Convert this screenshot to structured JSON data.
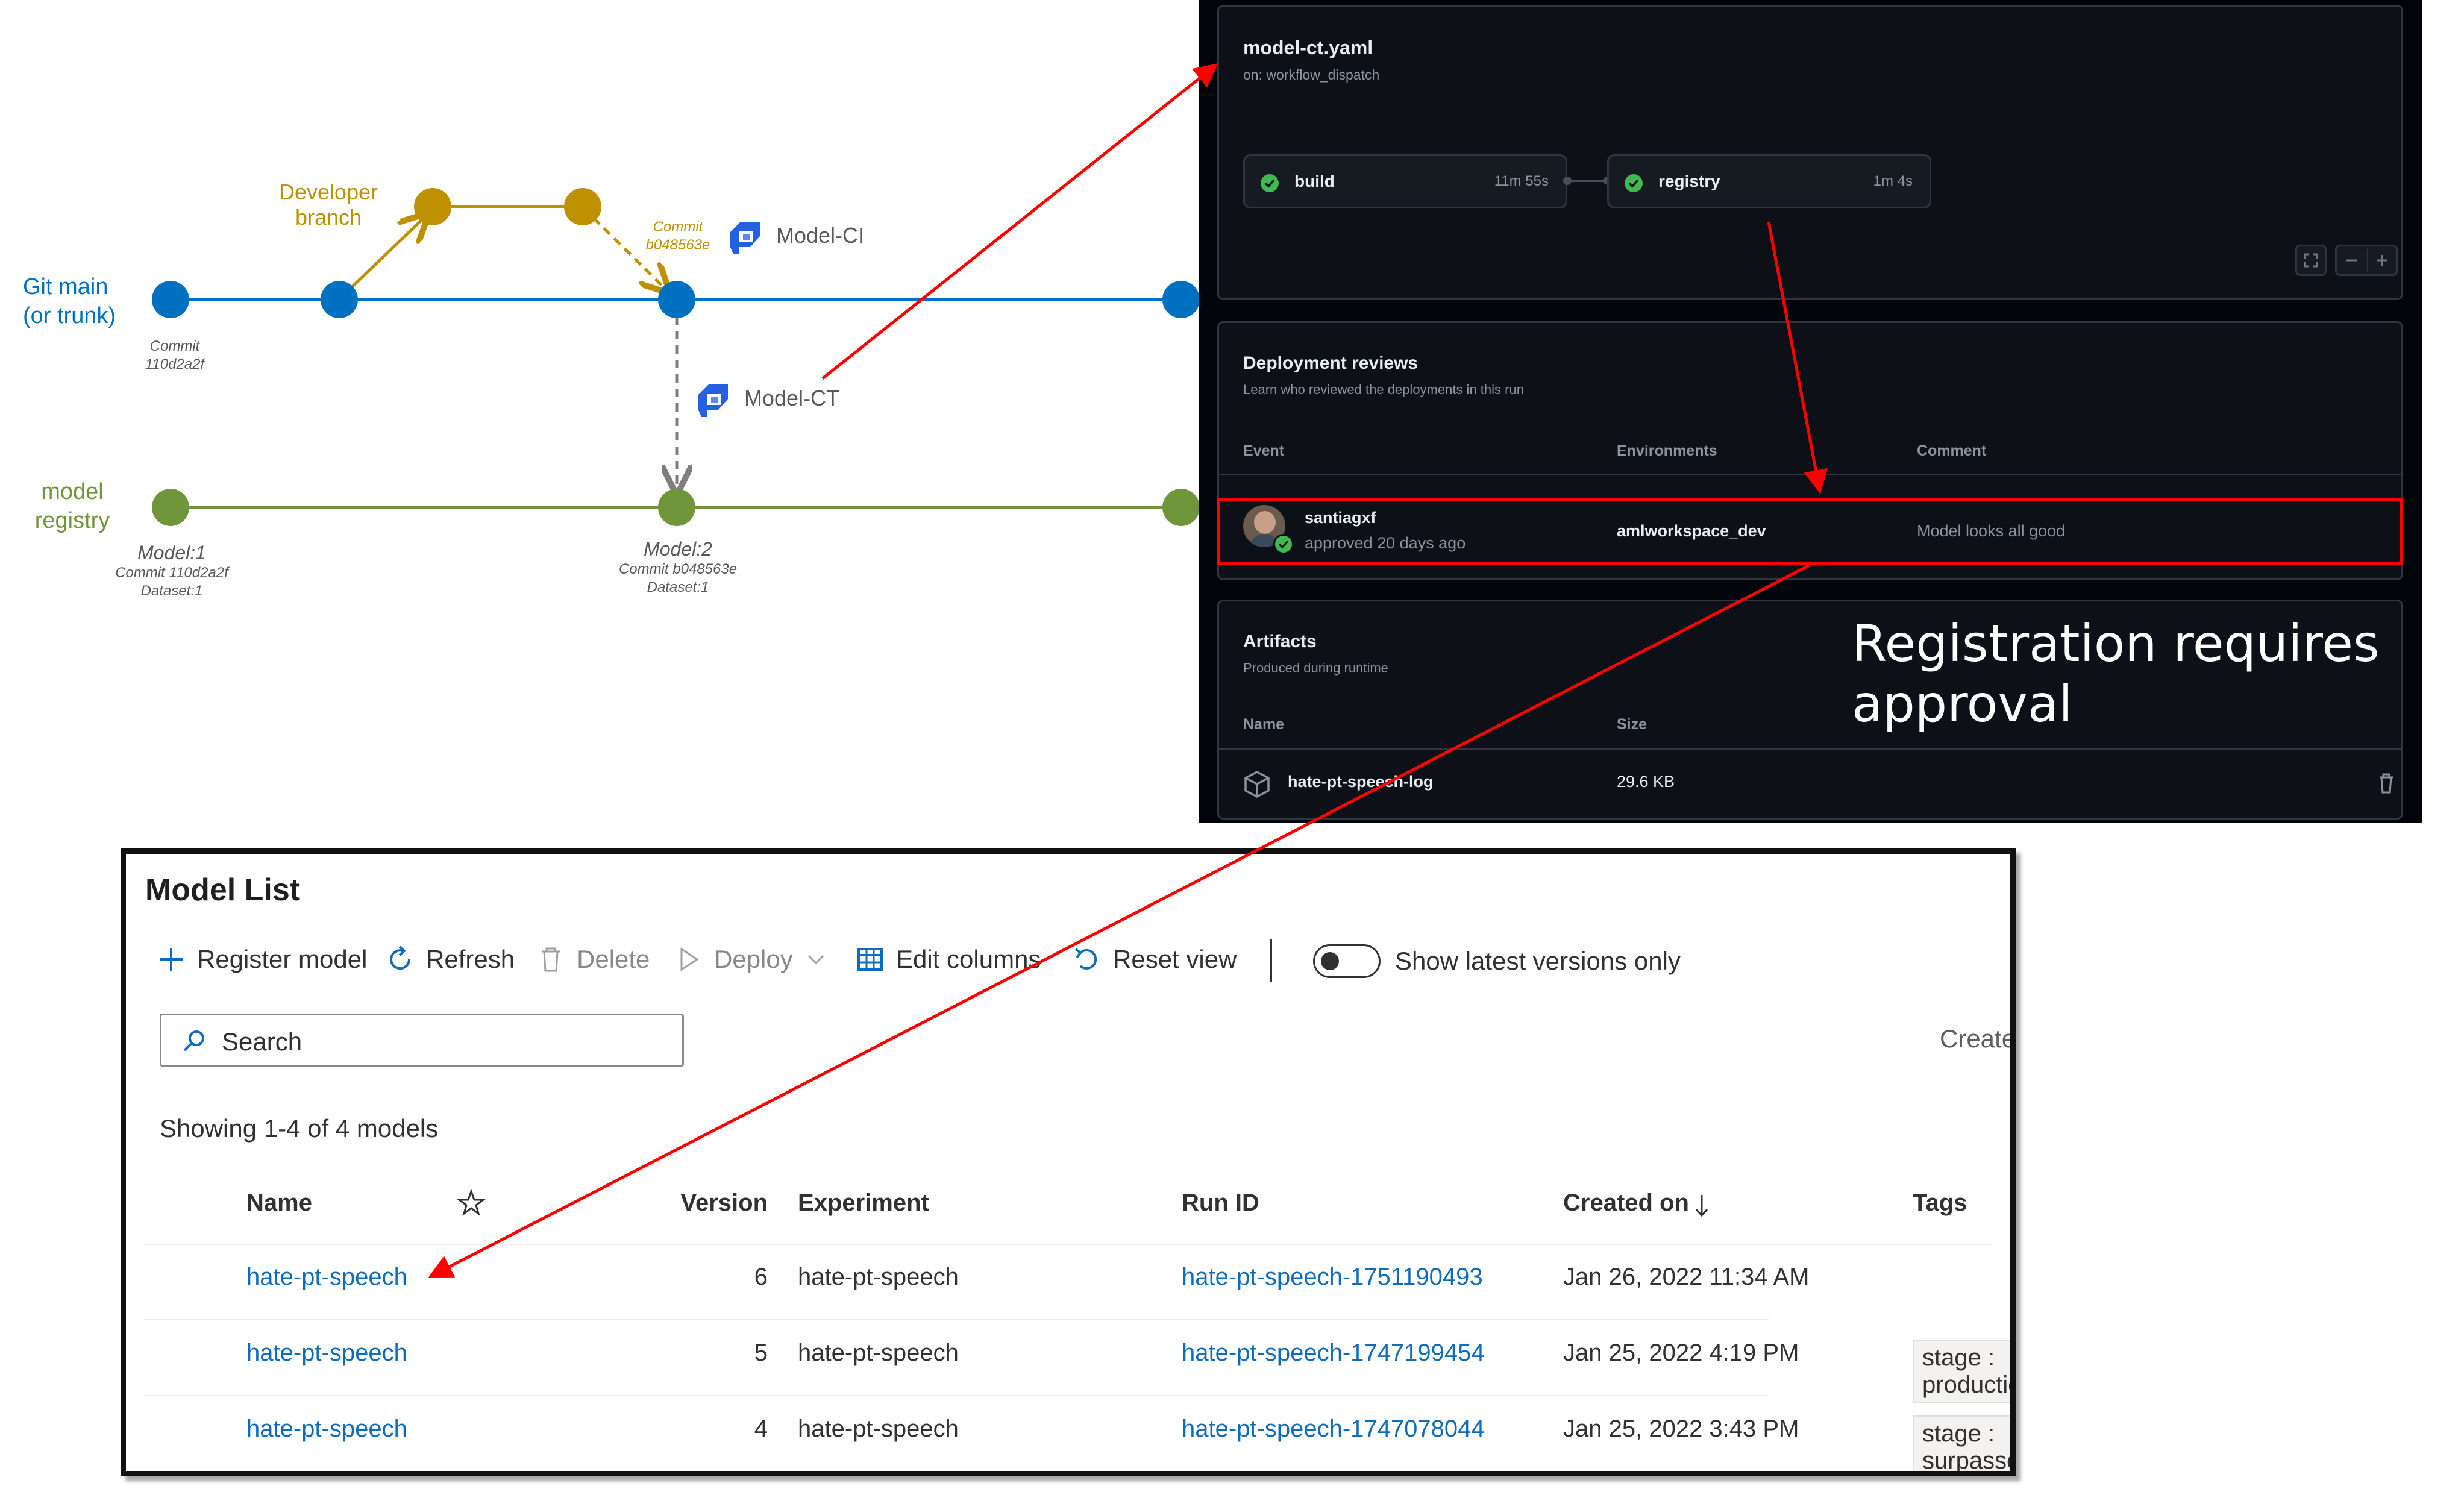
{
  "diagram": {
    "git_main_label": [
      "Git main",
      "(or trunk)"
    ],
    "developer_branch_label": [
      "Developer",
      "branch"
    ],
    "model_registry_label": [
      "model",
      "registry"
    ],
    "commit_main": [
      "Commit",
      "110d2a2f"
    ],
    "commit_dev": [
      "Commit",
      "b048563e"
    ],
    "model_ci_label": "Model-CI",
    "model_ct_label": "Model-CT",
    "model1": {
      "title": "Model:1",
      "lines": [
        "Commit 110d2a2f",
        "Dataset:1"
      ]
    },
    "model2": {
      "title": "Model:2",
      "lines": [
        "Commit b048563e",
        "Dataset:1"
      ]
    },
    "colors": {
      "main": "#0070c0",
      "branch": "#bf9000",
      "registry": "#70963c",
      "dashed": "#7f7f7f",
      "arrow": "#ff0000"
    }
  },
  "workflow": {
    "file": "model-ct.yaml",
    "trigger": "on: workflow_dispatch",
    "jobs": [
      {
        "name": "build",
        "duration": "11m 55s",
        "status": "success"
      },
      {
        "name": "registry",
        "duration": "1m 4s",
        "status": "success"
      }
    ],
    "deployment_reviews": {
      "title": "Deployment reviews",
      "subtitle": "Learn who reviewed the deployments in this run",
      "columns": [
        "Event",
        "Environments",
        "Comment"
      ],
      "row": {
        "user": "santiagxf",
        "status": "approved 20 days ago",
        "environment": "amlworkspace_dev",
        "comment": "Model looks all good"
      }
    },
    "artifacts": {
      "title": "Artifacts",
      "subtitle": "Produced during runtime",
      "columns": [
        "Name",
        "Size"
      ],
      "row": {
        "name": "hate-pt-speech-log",
        "size": "29.6 KB"
      }
    }
  },
  "callout": [
    "Registration requires",
    "approval"
  ],
  "model_list": {
    "title": "Model List",
    "toolbar": {
      "register": "Register model",
      "refresh": "Refresh",
      "delete": "Delete",
      "deploy": "Deploy",
      "edit_columns": "Edit columns",
      "reset_view": "Reset view",
      "toggle_label": "Show latest versions only",
      "toggle_on": false
    },
    "search_placeholder": "Search",
    "create_cut": "Create",
    "showing": "Showing 1-4 of 4 models",
    "columns": {
      "name": "Name",
      "version": "Version",
      "experiment": "Experiment",
      "run_id": "Run ID",
      "created_on": "Created on",
      "tags": "Tags"
    },
    "rows": [
      {
        "name": "hate-pt-speech",
        "version": "6",
        "experiment": "hate-pt-speech",
        "run_id": "hate-pt-speech-1751190493",
        "created_on": "Jan 26, 2022 11:34 AM",
        "tag": ""
      },
      {
        "name": "hate-pt-speech",
        "version": "5",
        "experiment": "hate-pt-speech",
        "run_id": "hate-pt-speech-1747199454",
        "created_on": "Jan 25, 2022 4:19 PM",
        "tag": "stage : production"
      },
      {
        "name": "hate-pt-speech",
        "version": "4",
        "experiment": "hate-pt-speech",
        "run_id": "hate-pt-speech-1747078044",
        "created_on": "Jan 25, 2022 3:43 PM",
        "tag": "stage : surpassed"
      }
    ]
  }
}
